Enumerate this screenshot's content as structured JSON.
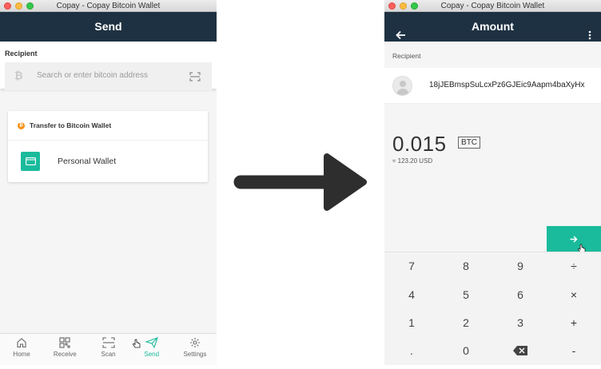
{
  "left_window": {
    "title": "Copay - Copay Bitcoin Wallet",
    "header": "Send",
    "recipient_label": "Recipient",
    "search_placeholder": "Search or enter bitcoin address",
    "transfer_heading": "Transfer to Bitcoin Wallet",
    "wallet_name": "Personal Wallet",
    "tabs": [
      {
        "label": "Home",
        "icon": "home-icon"
      },
      {
        "label": "Receive",
        "icon": "qr-code-icon"
      },
      {
        "label": "Scan",
        "icon": "scan-icon"
      },
      {
        "label": "Send",
        "icon": "send-icon",
        "active": true
      },
      {
        "label": "Settings",
        "icon": "gear-icon"
      }
    ]
  },
  "right_window": {
    "title": "Copay - Copay Bitcoin Wallet",
    "header": "Amount",
    "recipient_label": "Recipient",
    "recipient_address": "18jJEBmspSuLcxPz6GJEic9Aapm4baXyHx",
    "amount": "0.015",
    "unit": "BTC",
    "alt_amount": "≈ 123.20 USD",
    "keypad": [
      [
        "7",
        "8",
        "9",
        "÷"
      ],
      [
        "4",
        "5",
        "6",
        "×"
      ],
      [
        "1",
        "2",
        "3",
        "+"
      ],
      [
        ".",
        "0",
        "backspace",
        "-"
      ]
    ]
  },
  "colors": {
    "navbar": "#1e3142",
    "accent": "#1abb9c",
    "bitcoin": "#f7931a"
  }
}
